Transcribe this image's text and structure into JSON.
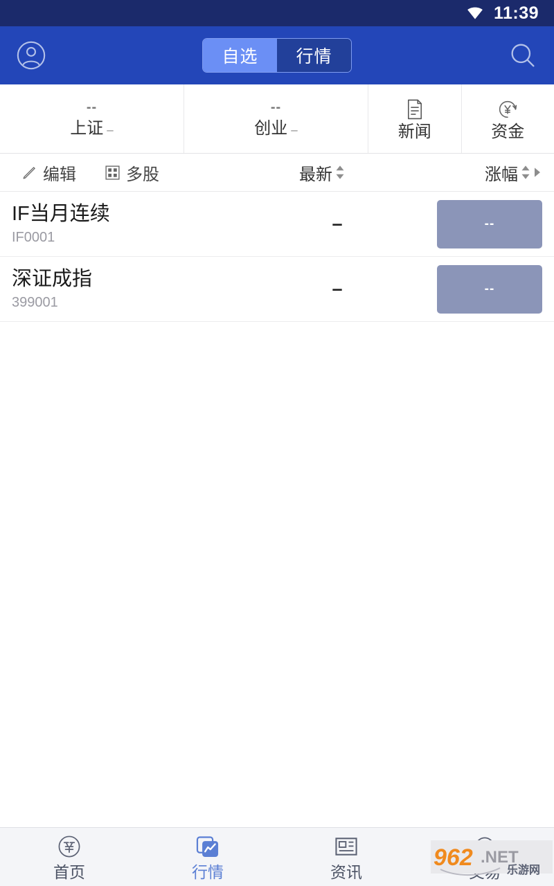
{
  "status_bar": {
    "time": "11:39",
    "wifi_icon": "wifi-icon"
  },
  "header": {
    "avatar_icon": "user-avatar-icon",
    "search_icon": "search-icon",
    "segments": [
      {
        "label": "自选",
        "active": true
      },
      {
        "label": "行情",
        "active": false
      }
    ]
  },
  "index_row": {
    "indices": [
      {
        "value": "--",
        "name": "上证",
        "change": "–"
      },
      {
        "value": "--",
        "name": "创业",
        "change": "–"
      }
    ],
    "shortcuts": [
      {
        "label": "新闻",
        "icon": "news-document-icon"
      },
      {
        "label": "资金",
        "icon": "funds-yen-icon"
      }
    ]
  },
  "toolbar": {
    "edit_label": "编辑",
    "edit_icon": "pencil-icon",
    "multi_label": "多股",
    "multi_icon": "grid-icon",
    "latest_label": "最新",
    "change_label": "涨幅",
    "sort_icon": "sort-updown-icon",
    "next_icon": "chevron-right-icon"
  },
  "stock_list": [
    {
      "name": "IF当月连续",
      "code": "IF0001",
      "price": "–",
      "change_badge": "--"
    },
    {
      "name": "深证成指",
      "code": "399001",
      "price": "–",
      "change_badge": "--"
    }
  ],
  "bottom_nav": [
    {
      "label": "首页",
      "icon": "home-coupon-icon",
      "active": false
    },
    {
      "label": "行情",
      "icon": "market-chart-icon",
      "active": true
    },
    {
      "label": "资讯",
      "icon": "news-list-icon",
      "active": false
    },
    {
      "label": "交易",
      "icon": "trade-yen-icon",
      "active": false
    }
  ],
  "watermark": {
    "main": "962",
    "suffix": ".NET",
    "sub": "乐游网"
  },
  "colors": {
    "status_bar": "#1b2a6b",
    "header": "#2346b8",
    "segment_active": "#6b8ff5",
    "segment_inactive": "#22409a",
    "badge": "#8b95b8",
    "nav_active": "#5b7fd4",
    "page_bg": "#ffffff",
    "nav_bg": "#f4f5f8"
  }
}
